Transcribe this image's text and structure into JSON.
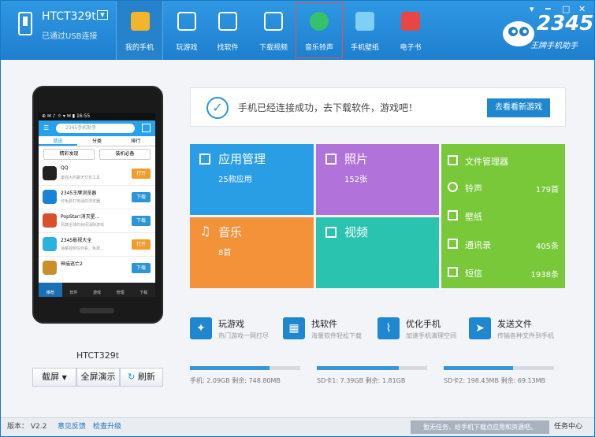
{
  "device": {
    "name": "HTCT329t",
    "status": "已通过USB连接",
    "model_label": "HTCT329t"
  },
  "nav": [
    {
      "label": "我的手机",
      "icon": "phone-app-icon",
      "color": "#f3b52b"
    },
    {
      "label": "玩游戏",
      "icon": "gamepad-icon",
      "color": "#ffffff"
    },
    {
      "label": "找软件",
      "icon": "software-bag-icon",
      "color": "#ffffff"
    },
    {
      "label": "下载视频",
      "icon": "film-icon",
      "color": "#ffffff"
    },
    {
      "label": "音乐铃声",
      "icon": "music-note-icon",
      "color": "#35c26b"
    },
    {
      "label": "手机壁纸",
      "icon": "wallpaper-icon",
      "color": "#7fd0f7"
    },
    {
      "label": "电子书",
      "icon": "book-icon",
      "color": "#e84545"
    }
  ],
  "brand": {
    "number": "2345",
    "slogan": "王牌手机助手"
  },
  "window_controls": {
    "menu": "▾",
    "min": "━",
    "max": "□",
    "close": "✕"
  },
  "phone_screen": {
    "status": "⊕ ✉ ♪ ☼ ▾ ✉ ▮ 16:55",
    "search_placeholder": "2345手机助手",
    "tabs": [
      "精选",
      "分类",
      "排行"
    ],
    "quick_buttons": [
      "精彩发现",
      "装机必备"
    ],
    "apps": [
      {
        "name": "QQ",
        "sub": "最强大的聊天交友工具",
        "btn": "打开",
        "btn_color": "#f39c2e",
        "icon_color": "#222222"
      },
      {
        "name": "2345王牌浏览器",
        "sub": "可免费打电话的浏览器",
        "btn": "下载",
        "btn_color": "#2c94d8",
        "icon_color": "#1b83d6"
      },
      {
        "name": "PopStar!消灭星...",
        "sub": "风靡全球的休闲消除游戏",
        "btn": "下载",
        "btn_color": "#2c94d8",
        "icon_color": "#d94f2b"
      },
      {
        "name": "2345影视大全",
        "sub": "海量视频任你看，免费...",
        "btn": "打开",
        "btn_color": "#f39c2e",
        "icon_color": "#2ab1e0"
      },
      {
        "name": "神庙逃亡2",
        "sub": "",
        "btn": "下载",
        "btn_color": "#2c94d8",
        "icon_color": "#c98f2d"
      }
    ],
    "bottom_nav": [
      "推荐",
      "软件",
      "游戏",
      "管理",
      "下载"
    ]
  },
  "device_controls": {
    "screenshot": "截屏",
    "dropdown": "▼",
    "present": "全屏演示",
    "refresh": "刷新"
  },
  "banner": {
    "message": "手机已经连接成功，去下载软件，游戏吧！",
    "button": "去看看新游戏"
  },
  "tiles": {
    "apps": {
      "title": "应用管理",
      "sub": "25款应用",
      "color": "#2a9ee5"
    },
    "photos": {
      "title": "照片",
      "sub": "152张",
      "color": "#b173d9"
    },
    "music": {
      "title": "音乐",
      "sub": "8首",
      "color": "#f4923a"
    },
    "video": {
      "title": "视频",
      "color": "#29c3b0"
    },
    "green_color": "#78c83a",
    "green_rows": [
      {
        "label": "文件管理器",
        "value": ""
      },
      {
        "label": "铃声",
        "value": "179首"
      },
      {
        "label": "壁纸",
        "value": ""
      },
      {
        "label": "通讯录",
        "value": "405条"
      },
      {
        "label": "短信",
        "value": "1938条"
      }
    ]
  },
  "actions": [
    {
      "title": "玩游戏",
      "sub": "热门游戏一网打尽"
    },
    {
      "title": "找软件",
      "sub": "海量软件轻松下载"
    },
    {
      "title": "优化手机",
      "sub": "加速手机清理空间"
    },
    {
      "title": "发送文件",
      "sub": "传输各种文件到手机"
    }
  ],
  "storage": [
    {
      "text": "手机: 2.09GB  剩余: 748.80MB",
      "used_fraction": 0.72
    },
    {
      "text": "SD卡1: 7.39GB  剩余: 1.81GB",
      "used_fraction": 0.74
    },
    {
      "text": "SD卡2: 198.43MB  剩余: 69.13MB",
      "used_fraction": 0.63
    }
  ],
  "footer": {
    "version": "版本： V2.2",
    "feedback": "意见反馈",
    "update": "检查升级",
    "task_status": "暂无任务，给手机下载点应用和资源吧。",
    "task_center": "任务中心"
  }
}
